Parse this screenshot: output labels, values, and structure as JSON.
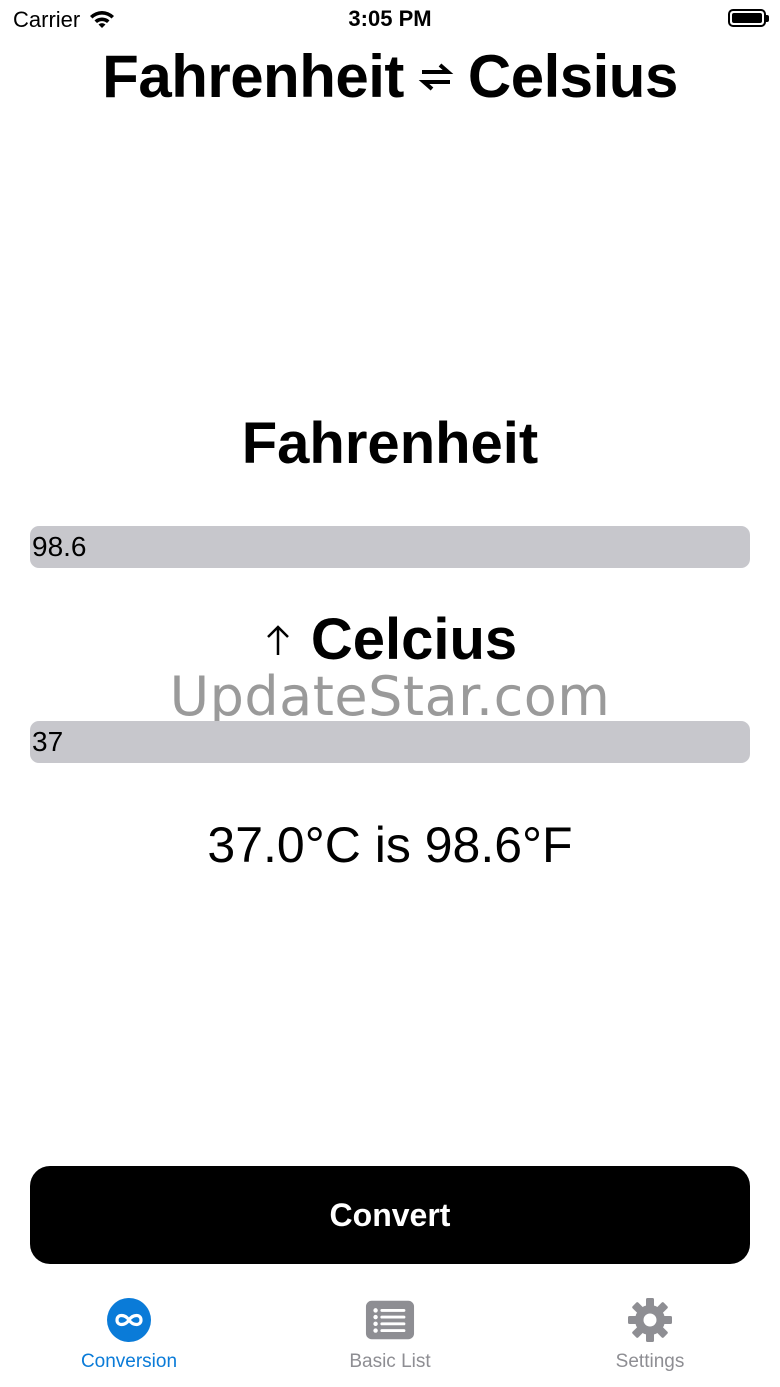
{
  "status_bar": {
    "carrier": "Carrier",
    "time": "3:05 PM"
  },
  "title": {
    "left": "Fahrenheit",
    "right": "Celsius",
    "icon": "swap-arrows-icon"
  },
  "fahrenheit": {
    "label": "Fahrenheit",
    "value": "98.6"
  },
  "celsius": {
    "label": "Celcius",
    "icon": "up-arrow-icon",
    "value": "37"
  },
  "watermark": "UpdateStar.com",
  "result": "37.0°C is 98.6°F",
  "convert_button": "Convert",
  "tabs": [
    {
      "label": "Conversion",
      "icon": "infinity-icon",
      "active": true
    },
    {
      "label": "Basic List",
      "icon": "list-icon",
      "active": false
    },
    {
      "label": "Settings",
      "icon": "gear-icon",
      "active": false
    }
  ],
  "colors": {
    "accent": "#0a7bd8",
    "field_bg": "#c7c7cc",
    "button_bg": "#000000",
    "inactive_tab": "#8e8e93"
  }
}
